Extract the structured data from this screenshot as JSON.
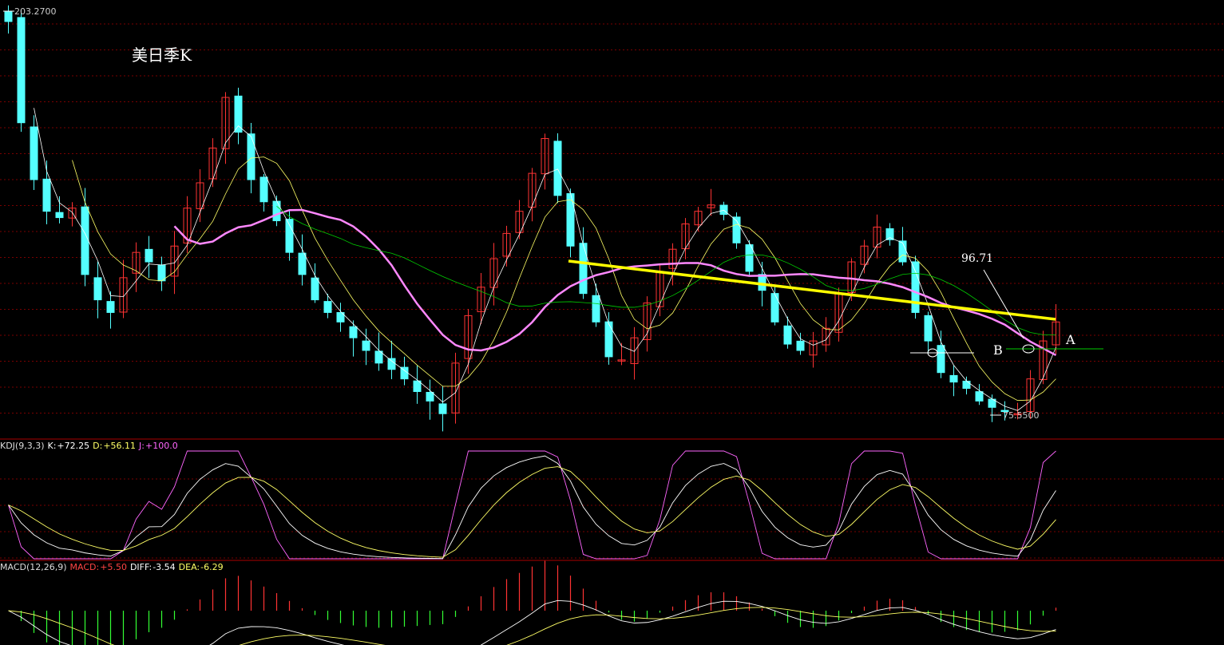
{
  "title": "美日季K",
  "price_high_label": "203.2700",
  "price_low_label": "75.5500",
  "annotations": {
    "level": "96.71",
    "point_a": "A",
    "point_b": "B"
  },
  "kdj": {
    "name": "KDJ(9,3,3)",
    "k_label": "K:",
    "k_value": "+72.25",
    "d_label": "D:",
    "d_value": "+56.11",
    "j_label": "J:",
    "j_value": "+100.0"
  },
  "macd": {
    "name": "MACD(12,26,9)",
    "macd_label": "MACD:",
    "macd_value": "+5.50",
    "diff_label": "DIFF:",
    "diff_value": "-3.54",
    "dea_label": "DEA:",
    "dea_value": "-6.29"
  },
  "colors": {
    "background": "#000000",
    "up": "#ff3333",
    "down": "#54ffff",
    "grid": "#7a0000",
    "ma_short": "#ffffff",
    "ma_mid": "#ffff66",
    "ma_long": "#ff88ff",
    "ma_longer": "#00cc00",
    "trendline": "#ffff00",
    "kdj_k": "#ffffff",
    "kdj_d": "#ffff66",
    "kdj_j": "#ff66ff",
    "macd_diff": "#ffffff",
    "macd_dea": "#ffff66"
  },
  "chart_data": {
    "type": "candlestick",
    "ylim": [
      75.55,
      203.27
    ],
    "closes": [
      200,
      168,
      150,
      140,
      138,
      141,
      120,
      112,
      108,
      119,
      127,
      124,
      118,
      129,
      141,
      149,
      160,
      176,
      165,
      150,
      143,
      137,
      127,
      120,
      112,
      108,
      105,
      100,
      96,
      92,
      90,
      87,
      83,
      80,
      76,
      92,
      107,
      116,
      125,
      133,
      140,
      152,
      163,
      145,
      129,
      114,
      105,
      94,
      93,
      100,
      111,
      121,
      128,
      136,
      140,
      142,
      139,
      130,
      121,
      115,
      105,
      98,
      96,
      99,
      103,
      114,
      124,
      129,
      135,
      131,
      124,
      108,
      99,
      89,
      86,
      84,
      80,
      78,
      77,
      76,
      87,
      99,
      105
    ]
  }
}
